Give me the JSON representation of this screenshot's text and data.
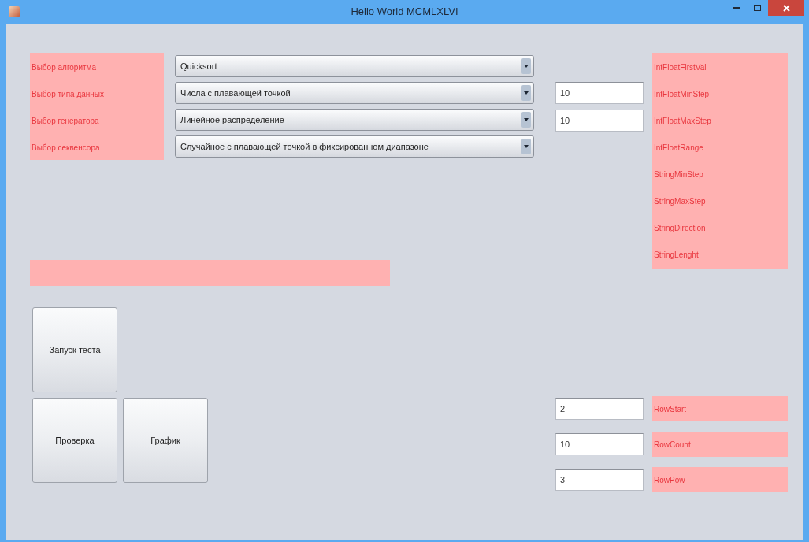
{
  "window": {
    "title": "Hello World MCMLXLVI"
  },
  "selector_labels": [
    "Выбор алгоритма",
    "Выбор типа данных",
    "Выбор генератора",
    "Выбор секвенсора"
  ],
  "selectors": [
    {
      "value": "Quicksort"
    },
    {
      "value": "Числа с плавающей точкой"
    },
    {
      "value": "Линейное распределение"
    },
    {
      "value": "Случайное с плавающей точкой в фиксированном диапазоне"
    }
  ],
  "step_fields": [
    "10",
    "10"
  ],
  "parameter_labels": [
    "IntFloatFirstVal",
    "IntFloatMinStep",
    "IntFloatMaxStep",
    "IntFloatRange",
    "StringMinStep",
    "StringMaxStep",
    "StringDirection",
    "StringLenght"
  ],
  "buttons": [
    {
      "label": "Запуск теста"
    },
    {
      "label": "Проверка"
    },
    {
      "label": "График"
    }
  ],
  "row_parameters": [
    {
      "value": "2",
      "label": "RowStart"
    },
    {
      "value": "10",
      "label": "RowCount"
    },
    {
      "value": "3",
      "label": "RowPow"
    }
  ]
}
